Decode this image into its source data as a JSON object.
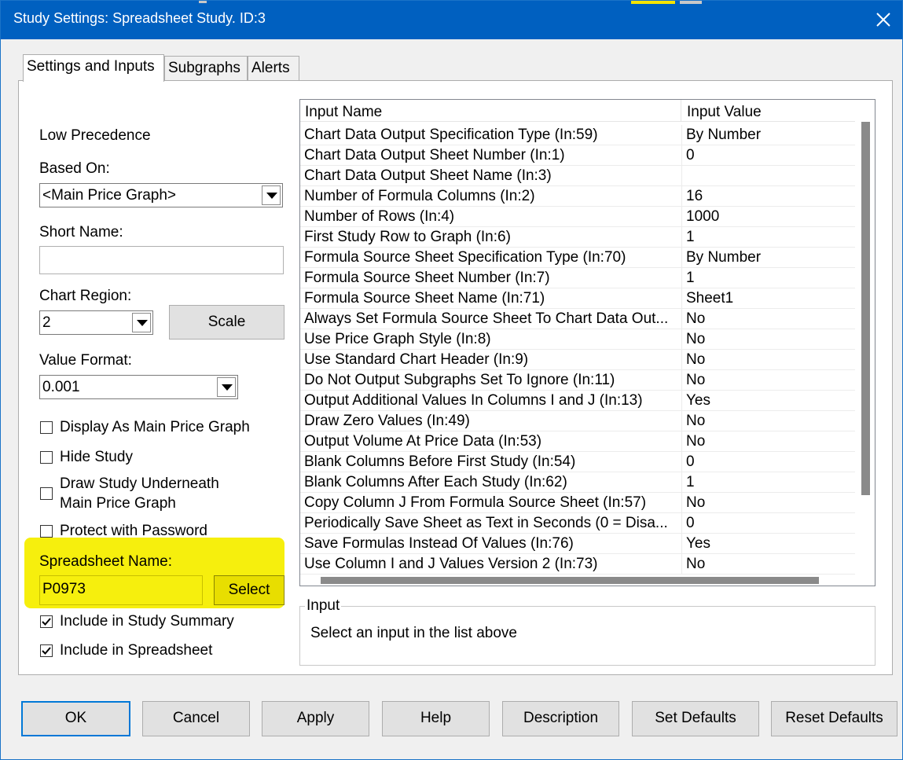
{
  "window": {
    "title": "Study Settings: Spreadsheet Study. ID:3"
  },
  "tabs": [
    {
      "label": "Settings and Inputs"
    },
    {
      "label": "Subgraphs"
    },
    {
      "label": "Alerts"
    }
  ],
  "left": {
    "precedence": "Low Precedence",
    "based_on_label": "Based On:",
    "based_on_value": "<Main Price Graph>",
    "short_name_label": "Short Name:",
    "short_name_value": "",
    "chart_region_label": "Chart Region:",
    "chart_region_value": "2",
    "scale_button": "Scale",
    "value_format_label": "Value Format:",
    "value_format_value": "0.001",
    "checkboxes": [
      {
        "label": "Display As Main Price Graph",
        "checked": false
      },
      {
        "label": "Hide Study",
        "checked": false
      },
      {
        "label": "Draw Study Underneath",
        "label2": "Main Price Graph",
        "checked": false
      },
      {
        "label": "Protect with Password",
        "checked": false
      }
    ],
    "spreadsheet_name_label": "Spreadsheet Name:",
    "spreadsheet_name_value": "P0973",
    "select_button": "Select",
    "include_summary": {
      "label": "Include in Study Summary",
      "checked": true
    },
    "include_spreadsheet": {
      "label": "Include in Spreadsheet",
      "checked": true
    }
  },
  "inputs_table": {
    "headers": [
      "Input Name",
      "Input Value"
    ],
    "rows": [
      {
        "name": "Chart Data Output Specification Type   (In:59)",
        "value": "By Number"
      },
      {
        "name": "Chart Data Output Sheet Number   (In:1)",
        "value": "0"
      },
      {
        "name": "Chart Data Output Sheet Name   (In:3)",
        "value": ""
      },
      {
        "name": "Number of Formula Columns   (In:2)",
        "value": "16"
      },
      {
        "name": "Number of Rows   (In:4)",
        "value": "1000"
      },
      {
        "name": "First Study Row to Graph   (In:6)",
        "value": "1"
      },
      {
        "name": "Formula Source Sheet Specification Type   (In:70)",
        "value": "By Number"
      },
      {
        "name": "Formula Source Sheet Number   (In:7)",
        "value": "1"
      },
      {
        "name": "Formula Source Sheet Name   (In:71)",
        "value": "Sheet1"
      },
      {
        "name": "Always Set Formula Source Sheet To Chart Data Out...",
        "value": "No"
      },
      {
        "name": "Use Price Graph Style   (In:8)",
        "value": "No"
      },
      {
        "name": "Use Standard Chart Header   (In:9)",
        "value": "No"
      },
      {
        "name": "Do Not Output Subgraphs Set To Ignore   (In:11)",
        "value": "No"
      },
      {
        "name": "Output Additional Values In Columns I and J   (In:13)",
        "value": "Yes"
      },
      {
        "name": "Draw Zero Values   (In:49)",
        "value": "No"
      },
      {
        "name": "Output Volume At Price Data   (In:53)",
        "value": "No"
      },
      {
        "name": "Blank Columns Before First Study   (In:54)",
        "value": "0"
      },
      {
        "name": "Blank Columns After Each Study   (In:62)",
        "value": "1"
      },
      {
        "name": "Copy Column J From Formula Source Sheet   (In:57)",
        "value": "No"
      },
      {
        "name": "Periodically Save Sheet as Text in Seconds (0 = Disa...",
        "value": "0"
      },
      {
        "name": "Save Formulas Instead Of Values   (In:76)",
        "value": "Yes"
      },
      {
        "name": "Use Column I and J Values Version 2   (In:73)",
        "value": "No"
      }
    ]
  },
  "input_group": {
    "title": "Input",
    "text": "Select an input in the list above"
  },
  "buttons": [
    {
      "label": "OK"
    },
    {
      "label": "Cancel"
    },
    {
      "label": "Apply"
    },
    {
      "label": "Help"
    },
    {
      "label": "Description"
    },
    {
      "label": "Set Defaults"
    },
    {
      "label": "Reset Defaults"
    }
  ],
  "colors": {
    "titlebar": "#0060c0",
    "highlight": "#f6ee00"
  }
}
